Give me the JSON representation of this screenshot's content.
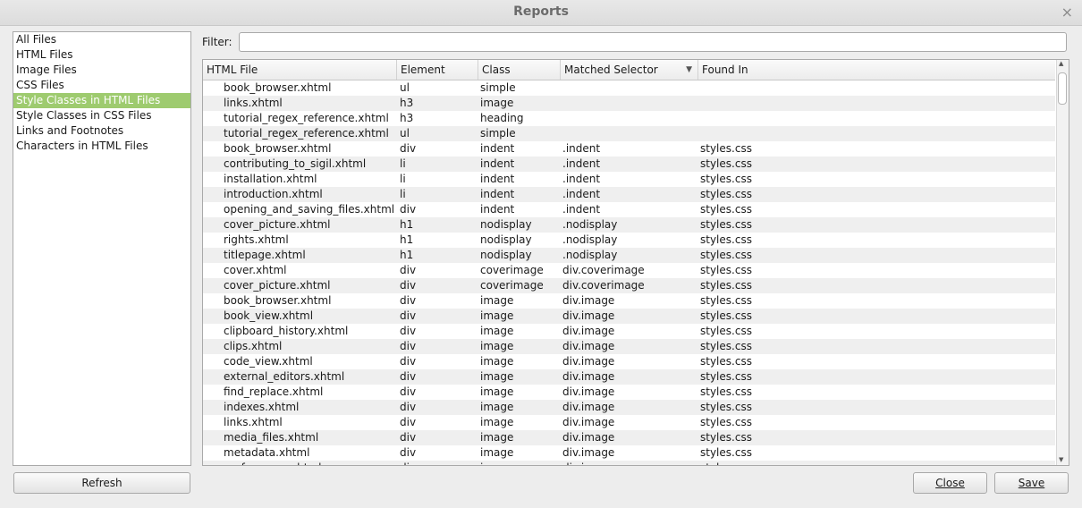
{
  "window": {
    "title": "Reports",
    "close_glyph": "×"
  },
  "sidebar": {
    "items": [
      {
        "label": "All Files"
      },
      {
        "label": "HTML Files"
      },
      {
        "label": "Image Files"
      },
      {
        "label": "CSS Files"
      },
      {
        "label": "Style Classes in HTML Files",
        "selected": true
      },
      {
        "label": "Style Classes in CSS Files"
      },
      {
        "label": "Links and Footnotes"
      },
      {
        "label": "Characters in HTML Files"
      }
    ]
  },
  "filter": {
    "label": "Filter:",
    "value": "",
    "placeholder": ""
  },
  "table": {
    "columns": [
      "HTML File",
      "Element",
      "Class",
      "Matched Selector",
      "Found In"
    ],
    "sort_column": "Matched Selector",
    "rows": [
      [
        "book_browser.xhtml",
        "ul",
        "simple",
        "",
        ""
      ],
      [
        "links.xhtml",
        "h3",
        "image",
        "",
        ""
      ],
      [
        "tutorial_regex_reference.xhtml",
        "h3",
        "heading",
        "",
        ""
      ],
      [
        "tutorial_regex_reference.xhtml",
        "ul",
        "simple",
        "",
        ""
      ],
      [
        "book_browser.xhtml",
        "div",
        "indent",
        ".indent",
        "styles.css"
      ],
      [
        "contributing_to_sigil.xhtml",
        "li",
        "indent",
        ".indent",
        "styles.css"
      ],
      [
        "installation.xhtml",
        "li",
        "indent",
        ".indent",
        "styles.css"
      ],
      [
        "introduction.xhtml",
        "li",
        "indent",
        ".indent",
        "styles.css"
      ],
      [
        "opening_and_saving_files.xhtml",
        "div",
        "indent",
        ".indent",
        "styles.css"
      ],
      [
        "cover_picture.xhtml",
        "h1",
        "nodisplay",
        ".nodisplay",
        "styles.css"
      ],
      [
        "rights.xhtml",
        "h1",
        "nodisplay",
        ".nodisplay",
        "styles.css"
      ],
      [
        "titlepage.xhtml",
        "h1",
        "nodisplay",
        ".nodisplay",
        "styles.css"
      ],
      [
        "cover.xhtml",
        "div",
        "coverimage",
        "div.coverimage",
        "styles.css"
      ],
      [
        "cover_picture.xhtml",
        "div",
        "coverimage",
        "div.coverimage",
        "styles.css"
      ],
      [
        "book_browser.xhtml",
        "div",
        "image",
        "div.image",
        "styles.css"
      ],
      [
        "book_view.xhtml",
        "div",
        "image",
        "div.image",
        "styles.css"
      ],
      [
        "clipboard_history.xhtml",
        "div",
        "image",
        "div.image",
        "styles.css"
      ],
      [
        "clips.xhtml",
        "div",
        "image",
        "div.image",
        "styles.css"
      ],
      [
        "code_view.xhtml",
        "div",
        "image",
        "div.image",
        "styles.css"
      ],
      [
        "external_editors.xhtml",
        "div",
        "image",
        "div.image",
        "styles.css"
      ],
      [
        "find_replace.xhtml",
        "div",
        "image",
        "div.image",
        "styles.css"
      ],
      [
        "indexes.xhtml",
        "div",
        "image",
        "div.image",
        "styles.css"
      ],
      [
        "links.xhtml",
        "div",
        "image",
        "div.image",
        "styles.css"
      ],
      [
        "media_files.xhtml",
        "div",
        "image",
        "div.image",
        "styles.css"
      ],
      [
        "metadata.xhtml",
        "div",
        "image",
        "div.image",
        "styles.css"
      ],
      [
        "preferences.xhtml",
        "div",
        "image",
        "div.image",
        "styles.css"
      ]
    ]
  },
  "buttons": {
    "refresh": "Refresh",
    "close": "Close",
    "save": "Save"
  },
  "icons": {
    "sort": "sort-descending-icon",
    "scroll_up": "scroll-up-icon",
    "scroll_down": "scroll-down-icon"
  }
}
